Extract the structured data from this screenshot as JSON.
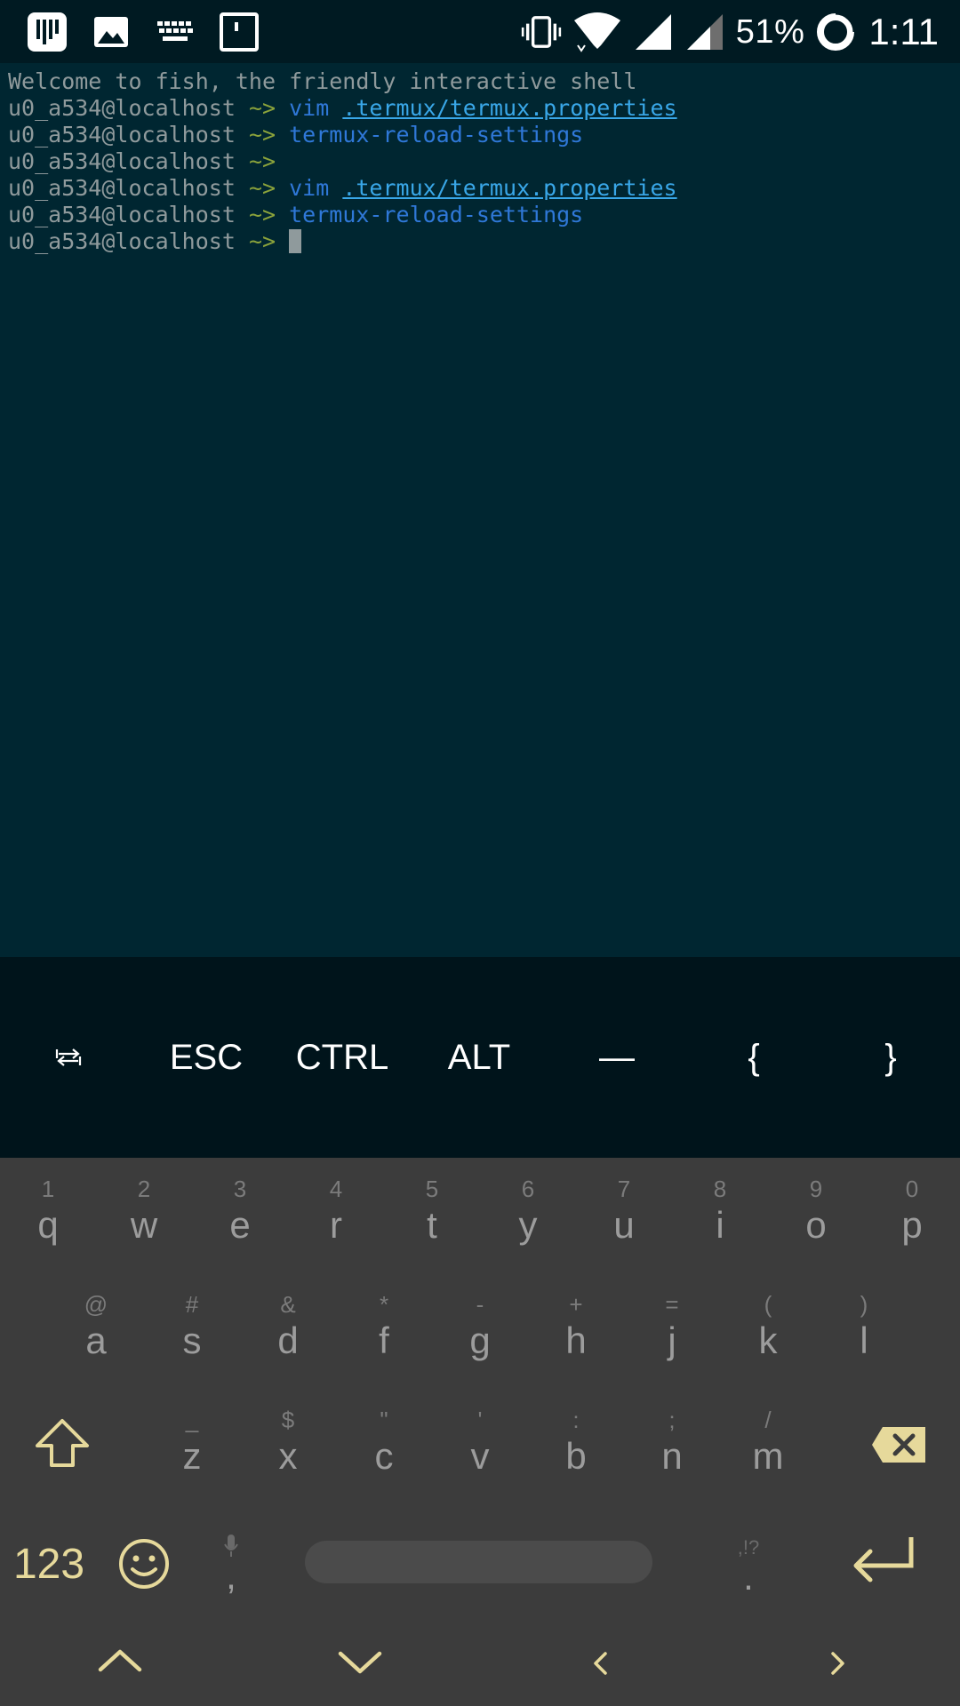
{
  "status_bar": {
    "battery_percent": "51%",
    "time": "1:11"
  },
  "terminal": {
    "welcome": "Welcome to fish, the friendly interactive shell",
    "prompt_user": "u0_a534@localhost",
    "prompt_symbol": "~>",
    "lines": [
      {
        "cmd": "vim",
        "arg": ".termux/termux.properties"
      },
      {
        "cmd": "termux-reload-settings",
        "arg": ""
      },
      {
        "cmd": "",
        "arg": ""
      },
      {
        "cmd": "vim",
        "arg": ".termux/termux.properties"
      },
      {
        "cmd": "termux-reload-settings",
        "arg": ""
      }
    ]
  },
  "extra_keys": {
    "tab": "⭾",
    "esc": "ESC",
    "ctrl": "CTRL",
    "alt": "ALT",
    "dash": "—",
    "lbrace": "{",
    "rbrace": "}"
  },
  "keyboard": {
    "row1": [
      {
        "hint": "1",
        "key": "q"
      },
      {
        "hint": "2",
        "key": "w"
      },
      {
        "hint": "3",
        "key": "e"
      },
      {
        "hint": "4",
        "key": "r"
      },
      {
        "hint": "5",
        "key": "t"
      },
      {
        "hint": "6",
        "key": "y"
      },
      {
        "hint": "7",
        "key": "u"
      },
      {
        "hint": "8",
        "key": "i"
      },
      {
        "hint": "9",
        "key": "o"
      },
      {
        "hint": "0",
        "key": "p"
      }
    ],
    "row2": [
      {
        "hint": "@",
        "key": "a"
      },
      {
        "hint": "#",
        "key": "s"
      },
      {
        "hint": "&",
        "key": "d"
      },
      {
        "hint": "*",
        "key": "f"
      },
      {
        "hint": "-",
        "key": "g"
      },
      {
        "hint": "+",
        "key": "h"
      },
      {
        "hint": "=",
        "key": "j"
      },
      {
        "hint": "(",
        "key": "k"
      },
      {
        "hint": ")",
        "key": "l"
      }
    ],
    "row3": [
      {
        "hint": "_",
        "key": "z"
      },
      {
        "hint": "$",
        "key": "x"
      },
      {
        "hint": "\"",
        "key": "c"
      },
      {
        "hint": "'",
        "key": "v"
      },
      {
        "hint": ":",
        "key": "b"
      },
      {
        "hint": ";",
        "key": "n"
      },
      {
        "hint": "/",
        "key": "m"
      }
    ],
    "numbers_label": "123",
    "comma": ",",
    "period": ".",
    "period_hint": ",!?"
  }
}
